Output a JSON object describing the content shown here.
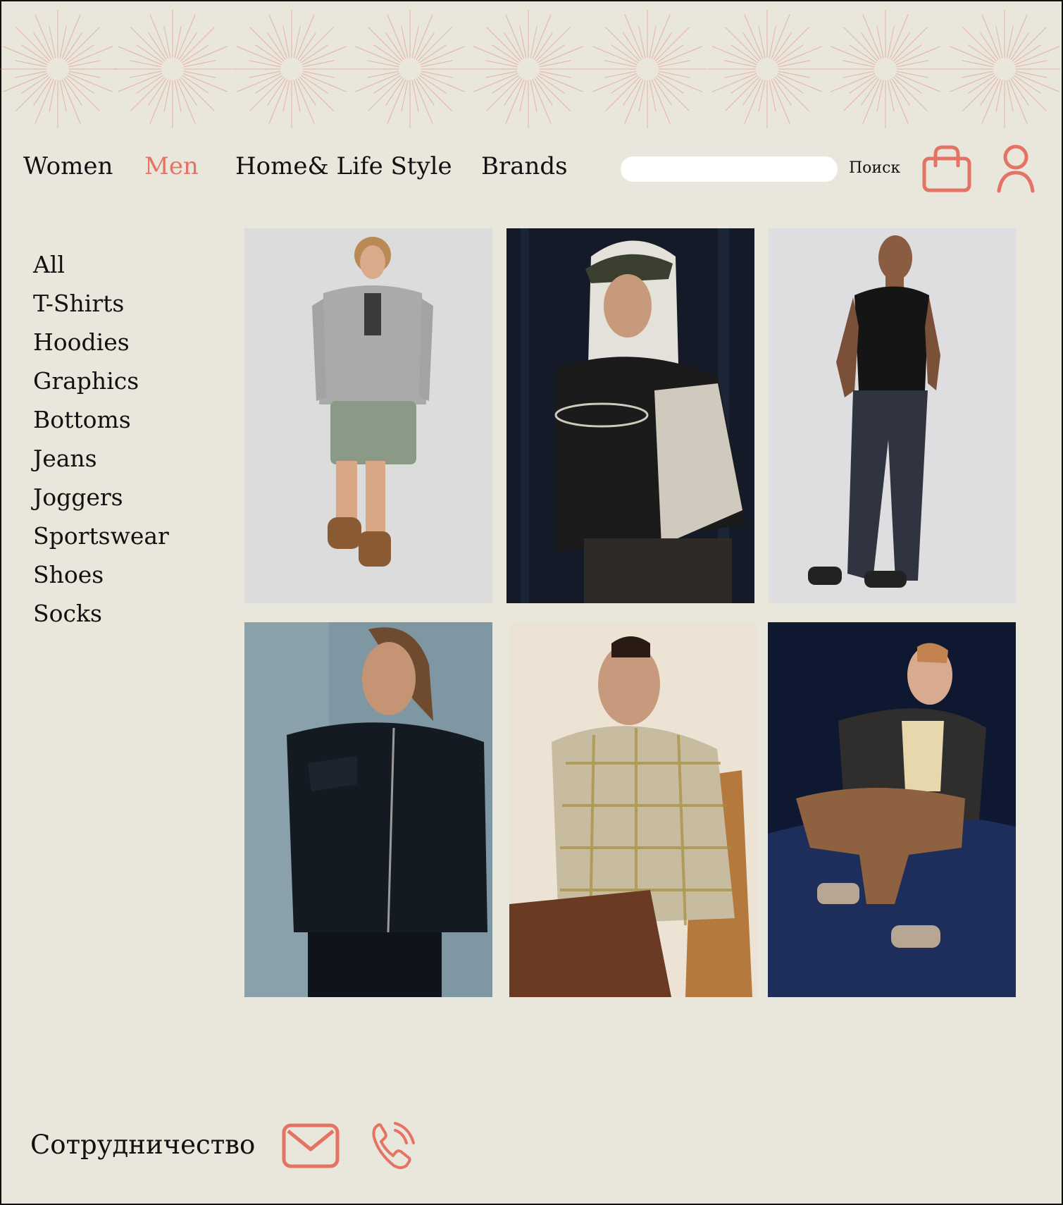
{
  "nav": {
    "women": "Women",
    "men": "Men",
    "home_life": "Home& Life Style",
    "brands": "Brands"
  },
  "search": {
    "placeholder": "",
    "button_label": "Поиск"
  },
  "sidebar": {
    "items": [
      "All",
      "T-Shirts",
      "Hoodies",
      "Graphics",
      "Bottoms",
      "Jeans",
      "Joggers",
      "Sportswear",
      "Shoes",
      "Socks"
    ]
  },
  "products": [
    {
      "description": "Young man in grey zip hoodie, green shorts and tan boots"
    },
    {
      "description": "Man in cap and hood with black and white racing jacket"
    },
    {
      "description": "Tattooed man in black tank top and dark cargo pants"
    },
    {
      "description": "Long-haired man in dark suede zip jacket"
    },
    {
      "description": "Man in plaid overshirt seated on wooden chair"
    },
    {
      "description": "Man in bomber jacket and brown pants seated on blue fabric"
    }
  ],
  "footer": {
    "cooperation": "Сотрудничество"
  },
  "icons": {
    "banner": "sunburst-icon",
    "cart": "shopping-bag-icon",
    "account": "user-icon",
    "email": "mail-icon",
    "phone": "phone-icon"
  },
  "colors": {
    "background": "#e9e6db",
    "accent": "#e57363",
    "text": "#111111"
  }
}
